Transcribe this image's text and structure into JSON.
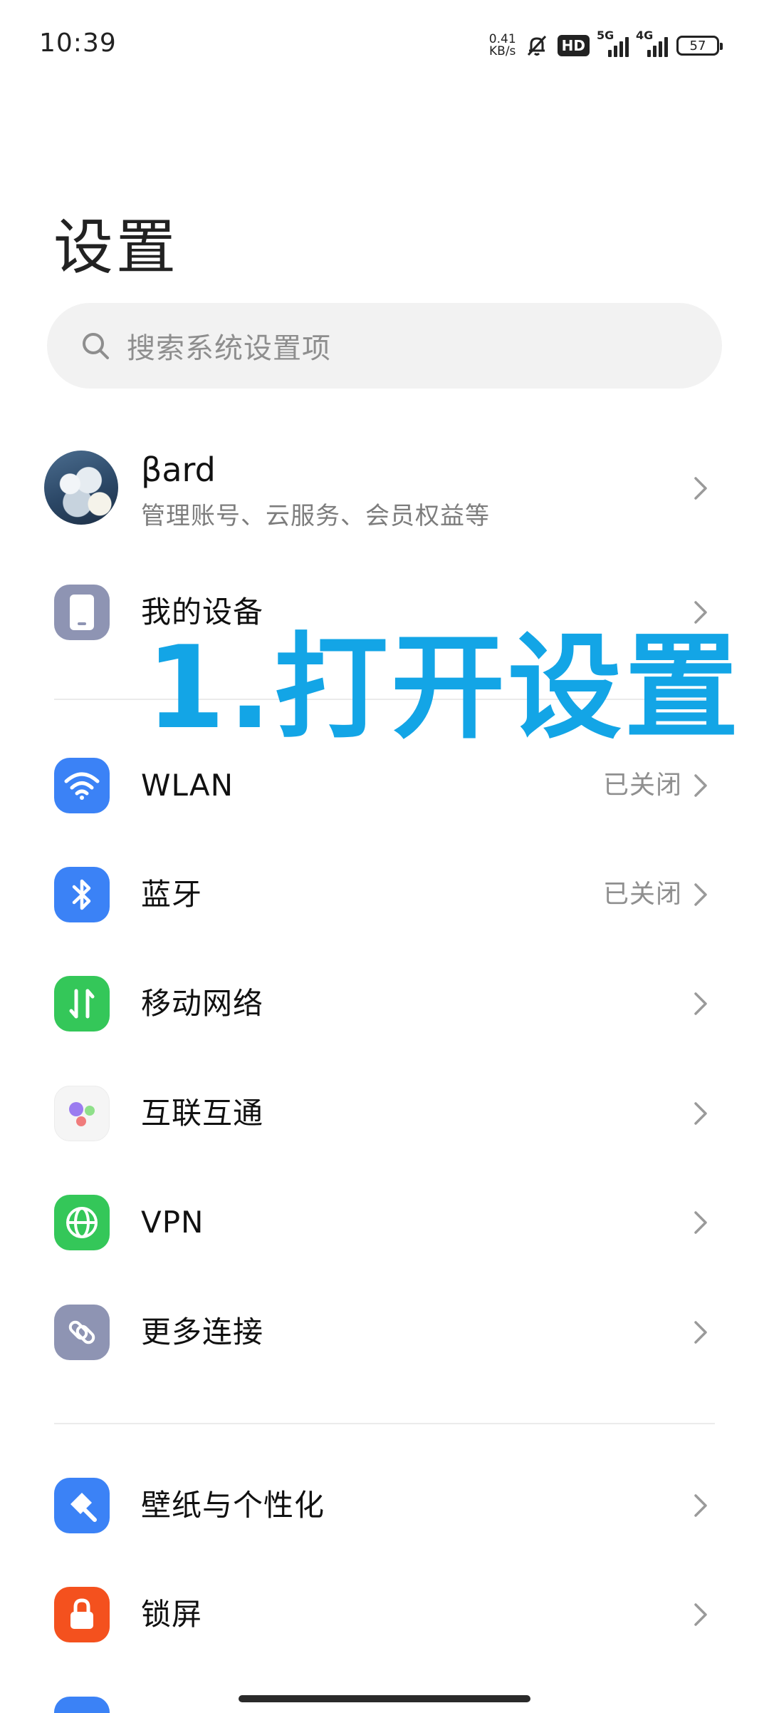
{
  "status_bar": {
    "time": "10:39",
    "net_speed_value": "0.41",
    "net_speed_unit": "KB/s",
    "hd_label": "HD",
    "sim1_type": "5G",
    "sim2_type": "4G",
    "battery_level": "57"
  },
  "header": {
    "title": "设置"
  },
  "search": {
    "placeholder": "搜索系统设置项"
  },
  "account": {
    "name": "βard",
    "subtitle": "管理账号、云服务、会员权益等"
  },
  "device_row": {
    "label": "我的设备",
    "icon": "phone-icon",
    "icon_color": "#8e94b3"
  },
  "connectivity": [
    {
      "label": "WLAN",
      "value": "已关闭",
      "icon": "wifi-icon",
      "icon_color": "#3b82f6"
    },
    {
      "label": "蓝牙",
      "value": "已关闭",
      "icon": "bluetooth-icon",
      "icon_color": "#3b82f6"
    },
    {
      "label": "移动网络",
      "value": "",
      "icon": "mobile-data-icon",
      "icon_color": "#34c759"
    },
    {
      "label": "互联互通",
      "value": "",
      "icon": "interconnect-icon",
      "icon_color": "#f5f5f5"
    },
    {
      "label": "VPN",
      "value": "",
      "icon": "globe-icon",
      "icon_color": "#34c759"
    },
    {
      "label": "更多连接",
      "value": "",
      "icon": "link-icon",
      "icon_color": "#8e94b3"
    }
  ],
  "personalization": [
    {
      "label": "壁纸与个性化",
      "icon": "brush-icon",
      "icon_color": "#3b82f6"
    },
    {
      "label": "锁屏",
      "icon": "lock-icon",
      "icon_color": "#f4511e"
    }
  ],
  "annotation": {
    "text": "1.打开设置",
    "color": "#13a5e6"
  }
}
